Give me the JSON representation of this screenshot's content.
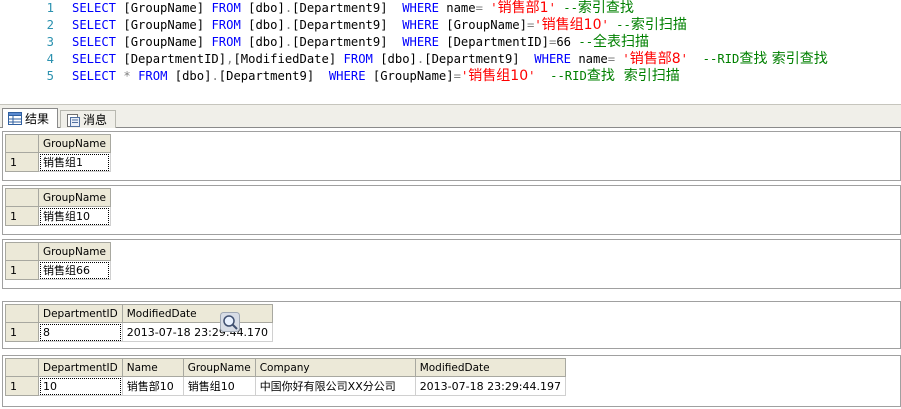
{
  "editor": {
    "lines": [
      {
        "num": "1",
        "tokens": [
          {
            "t": "SELECT ",
            "c": "kw"
          },
          {
            "t": "[GroupName] ",
            "c": "tx"
          },
          {
            "t": "FROM ",
            "c": "kw"
          },
          {
            "t": "[dbo]",
            "c": "tx"
          },
          {
            "t": ".",
            "c": "op"
          },
          {
            "t": "[Department9]  ",
            "c": "tx"
          },
          {
            "t": "WHERE ",
            "c": "kw"
          },
          {
            "t": "name",
            "c": "tx"
          },
          {
            "t": "= ",
            "c": "op"
          },
          {
            "t": "'",
            "c": "st"
          },
          {
            "t": "销售部1",
            "c": "st",
            "cjk": true
          },
          {
            "t": "'",
            "c": "st"
          },
          {
            "t": " --",
            "c": "cm"
          },
          {
            "t": "索引查找",
            "c": "cm",
            "cjk": true
          }
        ]
      },
      {
        "num": "2",
        "tokens": [
          {
            "t": "SELECT ",
            "c": "kw"
          },
          {
            "t": "[GroupName] ",
            "c": "tx"
          },
          {
            "t": "FROM ",
            "c": "kw"
          },
          {
            "t": "[dbo]",
            "c": "tx"
          },
          {
            "t": ".",
            "c": "op"
          },
          {
            "t": "[Department9]  ",
            "c": "tx"
          },
          {
            "t": "WHERE ",
            "c": "kw"
          },
          {
            "t": "[GroupName]",
            "c": "tx"
          },
          {
            "t": "=",
            "c": "op"
          },
          {
            "t": "'",
            "c": "st"
          },
          {
            "t": "销售组10",
            "c": "st",
            "cjk": true
          },
          {
            "t": "'",
            "c": "st"
          },
          {
            "t": " --",
            "c": "cm"
          },
          {
            "t": "索引扫描",
            "c": "cm",
            "cjk": true
          }
        ]
      },
      {
        "num": "3",
        "tokens": [
          {
            "t": "SELECT ",
            "c": "kw"
          },
          {
            "t": "[GroupName] ",
            "c": "tx"
          },
          {
            "t": "FROM ",
            "c": "kw"
          },
          {
            "t": "[dbo]",
            "c": "tx"
          },
          {
            "t": ".",
            "c": "op"
          },
          {
            "t": "[Department9]  ",
            "c": "tx"
          },
          {
            "t": "WHERE ",
            "c": "kw"
          },
          {
            "t": "[DepartmentID]",
            "c": "tx"
          },
          {
            "t": "=",
            "c": "op"
          },
          {
            "t": "66",
            "c": "tx"
          },
          {
            "t": " --",
            "c": "cm"
          },
          {
            "t": "全表扫描",
            "c": "cm",
            "cjk": true
          }
        ]
      },
      {
        "num": "4",
        "tokens": [
          {
            "t": "SELECT ",
            "c": "kw"
          },
          {
            "t": "[DepartmentID]",
            "c": "tx"
          },
          {
            "t": ",",
            "c": "op"
          },
          {
            "t": "[ModifiedDate] ",
            "c": "tx"
          },
          {
            "t": "FROM ",
            "c": "kw"
          },
          {
            "t": "[dbo]",
            "c": "tx"
          },
          {
            "t": ".",
            "c": "op"
          },
          {
            "t": "[Department9]  ",
            "c": "tx"
          },
          {
            "t": "WHERE ",
            "c": "kw"
          },
          {
            "t": "name",
            "c": "tx"
          },
          {
            "t": "= ",
            "c": "op"
          },
          {
            "t": "'",
            "c": "st"
          },
          {
            "t": "销售部8",
            "c": "st",
            "cjk": true
          },
          {
            "t": "'",
            "c": "st"
          },
          {
            "t": "  --RID",
            "c": "cm"
          },
          {
            "t": "查找 索引查找",
            "c": "cm",
            "cjk": true
          }
        ]
      },
      {
        "num": "5",
        "tokens": [
          {
            "t": "SELECT ",
            "c": "kw"
          },
          {
            "t": "* ",
            "c": "op"
          },
          {
            "t": "FROM ",
            "c": "kw"
          },
          {
            "t": "[dbo]",
            "c": "tx"
          },
          {
            "t": ".",
            "c": "op"
          },
          {
            "t": "[Department9]  ",
            "c": "tx"
          },
          {
            "t": "WHERE ",
            "c": "kw"
          },
          {
            "t": "[GroupName]",
            "c": "tx"
          },
          {
            "t": "=",
            "c": "op"
          },
          {
            "t": "'",
            "c": "st"
          },
          {
            "t": "销售组10",
            "c": "st",
            "cjk": true
          },
          {
            "t": "'",
            "c": "st"
          },
          {
            "t": "  --RID",
            "c": "cm"
          },
          {
            "t": "查找  索引扫描",
            "c": "cm",
            "cjk": true
          }
        ]
      }
    ]
  },
  "tabs": {
    "results_label": "结果",
    "messages_label": "消息"
  },
  "results": [
    {
      "columns": [
        "GroupName"
      ],
      "rows": [
        {
          "num": "1",
          "cells": [
            "销售组1"
          ]
        }
      ]
    },
    {
      "columns": [
        "GroupName"
      ],
      "rows": [
        {
          "num": "1",
          "cells": [
            "销售组10"
          ]
        }
      ]
    },
    {
      "columns": [
        "GroupName"
      ],
      "rows": [
        {
          "num": "1",
          "cells": [
            "销售组66"
          ]
        }
      ]
    },
    {
      "columns": [
        "DepartmentID",
        "ModifiedDate"
      ],
      "rows": [
        {
          "num": "1",
          "cells": [
            "8",
            "2013-07-18 23:29:44.170"
          ]
        }
      ]
    },
    {
      "columns": [
        "DepartmentID",
        "Name",
        "GroupName",
        "Company",
        "ModifiedDate"
      ],
      "rows": [
        {
          "num": "1",
          "cells": [
            "10",
            "销售部10",
            "销售组10",
            "中国你好有限公司XX分公司",
            "2013-07-18 23:29:44.197"
          ]
        }
      ]
    }
  ],
  "icons": {
    "results_tab": "grid-icon",
    "messages_tab": "message-icon",
    "zoom": "magnifier-icon"
  }
}
